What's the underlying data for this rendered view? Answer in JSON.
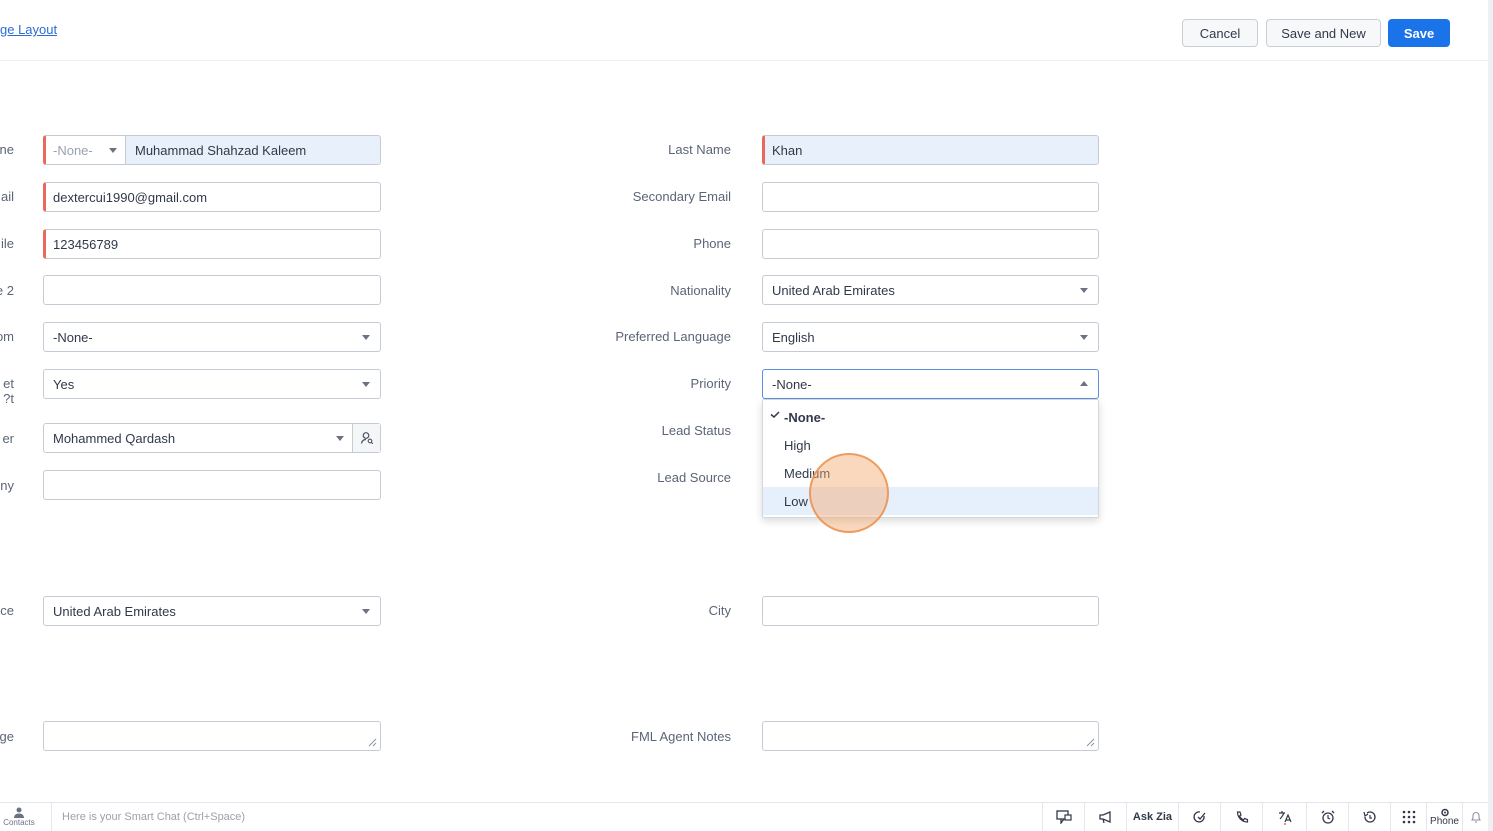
{
  "header": {
    "layout_link": "ge Layout",
    "cancel_label": "Cancel",
    "save_new_label": "Save and New",
    "save_label": "Save"
  },
  "left_labels": [
    "ne",
    "ail",
    "ile",
    "e 2",
    "om",
    "et",
    "t?",
    "er",
    "ny",
    "ce",
    "ge"
  ],
  "left_fields": {
    "salutation": "-None-",
    "first_name": "Muhammad Shahzad Kaleem",
    "email": "dextercui1990@gmail.com",
    "mobile": "123456789",
    "phone2": "",
    "from": "-None-",
    "meet": "Yes",
    "owner": "Mohammed Qardash",
    "company": "",
    "residence": "United Arab Emirates",
    "message": ""
  },
  "right_labels": {
    "last_name": "Last Name",
    "secondary_email": "Secondary Email",
    "phone": "Phone",
    "nationality": "Nationality",
    "preferred_language": "Preferred Language",
    "priority": "Priority",
    "lead_status": "Lead Status",
    "lead_source": "Lead Source",
    "city": "City",
    "fml_agent_notes": "FML Agent Notes"
  },
  "right_fields": {
    "last_name": "Khan",
    "secondary_email": "",
    "phone": "",
    "nationality": "United Arab Emirates",
    "preferred_language": "English",
    "priority": "-None-",
    "city": "",
    "fml_agent_notes": ""
  },
  "priority_options": [
    "-None-",
    "High",
    "Medium",
    "Low"
  ],
  "priority_selected": "-None-",
  "priority_highlighted": "Low",
  "footer": {
    "contacts_label": "Contacts",
    "smart_chat": "Here is your Smart Chat (Ctrl+Space)",
    "ask_zia": "Ask Zia",
    "phone": "Phone"
  },
  "colors": {
    "primary": "#1a73e8",
    "required": "#e96a5a",
    "filled": "#e8f0fc",
    "highlight": "#e6effc",
    "cursor": "#f3a86e"
  }
}
